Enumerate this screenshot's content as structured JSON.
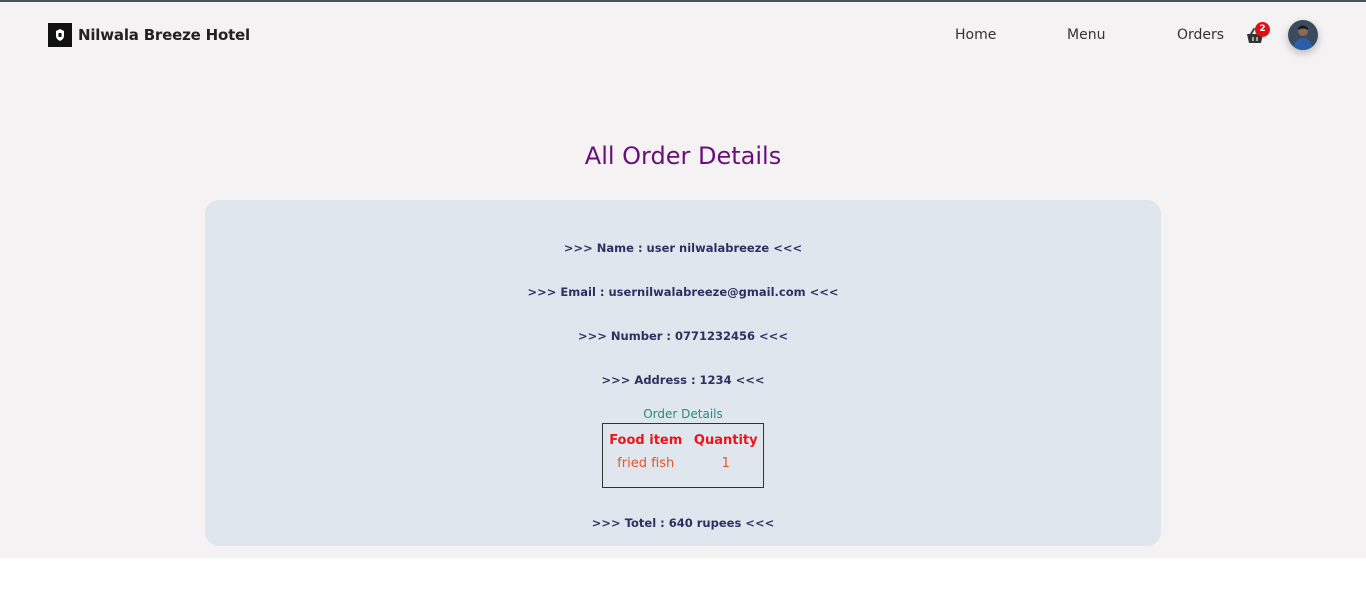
{
  "header": {
    "brand_name": "Nilwala Breeze Hotel",
    "nav": {
      "home": "Home",
      "menu": "Menu",
      "orders": "Orders"
    },
    "cart_count": "2"
  },
  "main": {
    "title": "All Order Details",
    "order": {
      "name_line": ">>> Name : user nilwalabreeze <<<",
      "email_line": ">>> Email : usernilwalabreeze@gmail.com <<<",
      "number_line": ">>> Number : 0771232456 <<<",
      "address_line": ">>> Address : 1234 <<<",
      "details_caption": "Order Details",
      "table": {
        "headers": [
          "Food item",
          "Quantity"
        ],
        "rows": [
          [
            "fried fish",
            "1"
          ]
        ]
      },
      "total_line": ">>> Totel : 640 rupees <<<"
    }
  },
  "colors": {
    "page_bg": "#f4f2f3",
    "card_bg": "#dfe6ed",
    "title": "#6a0f7a",
    "info_text": "#2e3060",
    "table_header": "#e8161a",
    "table_cell": "#e8532a",
    "badge": "#e01010"
  },
  "icons": {
    "brand_logo": "hotel-logo-icon",
    "cart": "shopping-basket-icon",
    "avatar": "user-avatar"
  }
}
